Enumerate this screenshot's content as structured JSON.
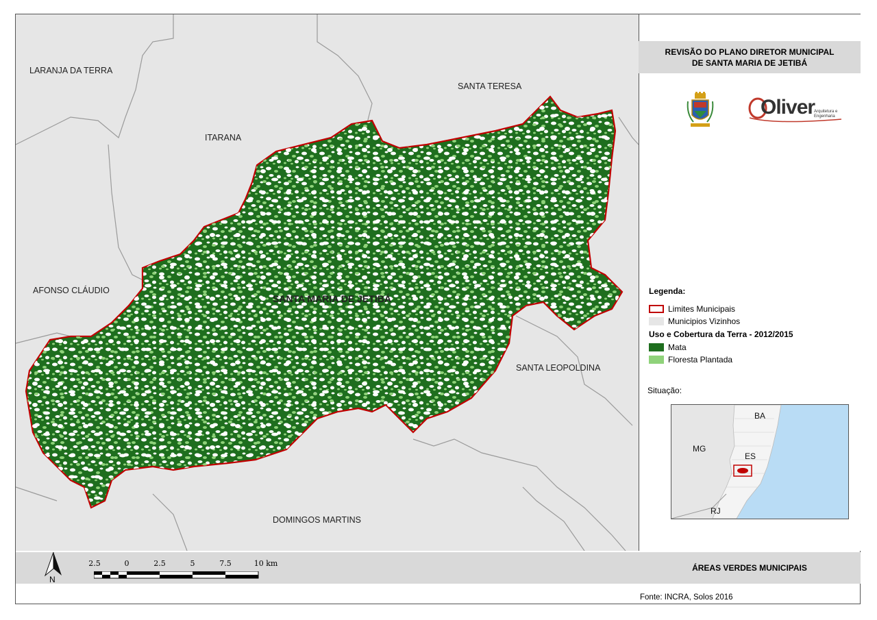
{
  "header": {
    "title_line1": "REVISÃO DO PLANO DIRETOR MUNICIPAL",
    "title_line2": "DE SANTA MARIA DE JETIBÁ"
  },
  "logos": {
    "oliver_wordmark": "Oliver",
    "oliver_tagline_1": "Arquitetura e",
    "oliver_tagline_2": "Engenharia"
  },
  "map": {
    "main_municipality": "SANTA MARIA DE JETIBÁ",
    "neighbors": [
      {
        "name": "LARANJA DA TERRA"
      },
      {
        "name": "SANTA TERESA"
      },
      {
        "name": "ITARANA"
      },
      {
        "name": "AFONSO CLÁUDIO"
      },
      {
        "name": "SANTA LEOPOLDINA"
      },
      {
        "name": "DOMINGOS MARTINS"
      }
    ],
    "colors": {
      "neighbors_fill": "#e6e6e6",
      "boundary": "#c00000",
      "mata": "#1e6e1e",
      "floresta_plantada": "#8fd27a",
      "ocean": "#b9dcf5"
    }
  },
  "legend": {
    "heading": "Legenda:",
    "items": [
      {
        "label": "Limites Municipais"
      },
      {
        "label": "Municipios Vizinhos"
      }
    ],
    "section_title": "Uso e Cobertura da Terra - 2012/2015",
    "classes": [
      {
        "label": "Mata"
      },
      {
        "label": "Floresta Plantada"
      }
    ]
  },
  "inset": {
    "heading": "Situação:",
    "states": [
      "BA",
      "MG",
      "ES",
      "RJ"
    ]
  },
  "scale_bar": {
    "ticks": [
      "2.5",
      "0",
      "2.5",
      "5",
      "7.5",
      "10 km"
    ]
  },
  "north_arrow": {
    "label": "N"
  },
  "footer": {
    "title": "ÁREAS VERDES MUNICIPAIS",
    "source": "Fonte: INCRA, Solos 2016"
  }
}
